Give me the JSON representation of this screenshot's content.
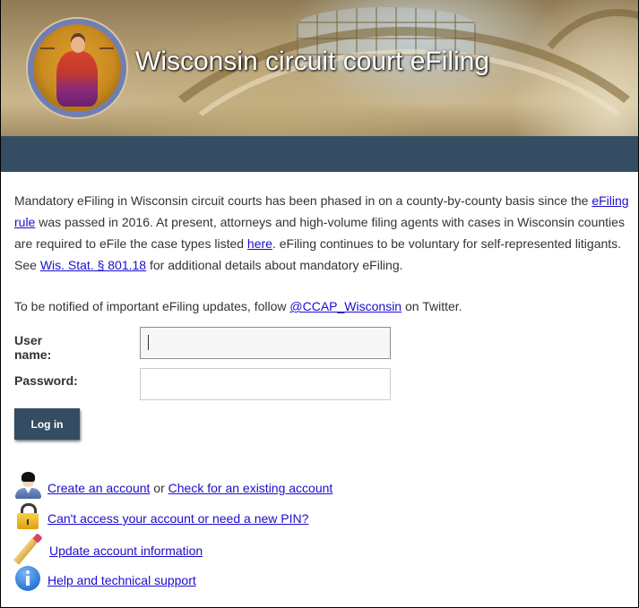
{
  "header": {
    "title": "Wisconsin circuit court eFiling",
    "seal_alt": "Justice seal"
  },
  "intro": {
    "text_1": "Mandatory eFiling in Wisconsin circuit courts has been phased in on a county-by-county basis since the ",
    "link_efiling_rule": "eFiling rule",
    "text_2": " was passed in 2016. At present, attorneys and high-volume filing agents with cases in Wisconsin counties are required to eFile the case types listed ",
    "link_here": "here",
    "text_3": ". eFiling continues to be voluntary for self-represented litigants. See ",
    "link_statute": "Wis. Stat. § 801.18",
    "text_4": " for additional details about mandatory eFiling."
  },
  "notify": {
    "text_1": "To be notified of important eFiling updates, follow ",
    "link_twitter": "@CCAP_Wisconsin",
    "text_2": " on Twitter."
  },
  "login": {
    "username_label": "User name:",
    "username_value": "",
    "password_label": "Password:",
    "password_value": "",
    "submit_label": "Log in"
  },
  "links": {
    "create_account": "Create an account",
    "or_text": " or ",
    "check_account": "Check for an existing account",
    "cant_access": "Can't access your account or need a new PIN?",
    "update_account": "Update account information",
    "help": "Help and technical support"
  },
  "icons": {
    "user": "user-icon",
    "lock": "lock-icon",
    "pencil": "pencil-icon",
    "info": "info-icon"
  },
  "colors": {
    "nav_bar": "#344d63",
    "button": "#344d63",
    "link": "#1a0dcc",
    "text": "#333333"
  }
}
